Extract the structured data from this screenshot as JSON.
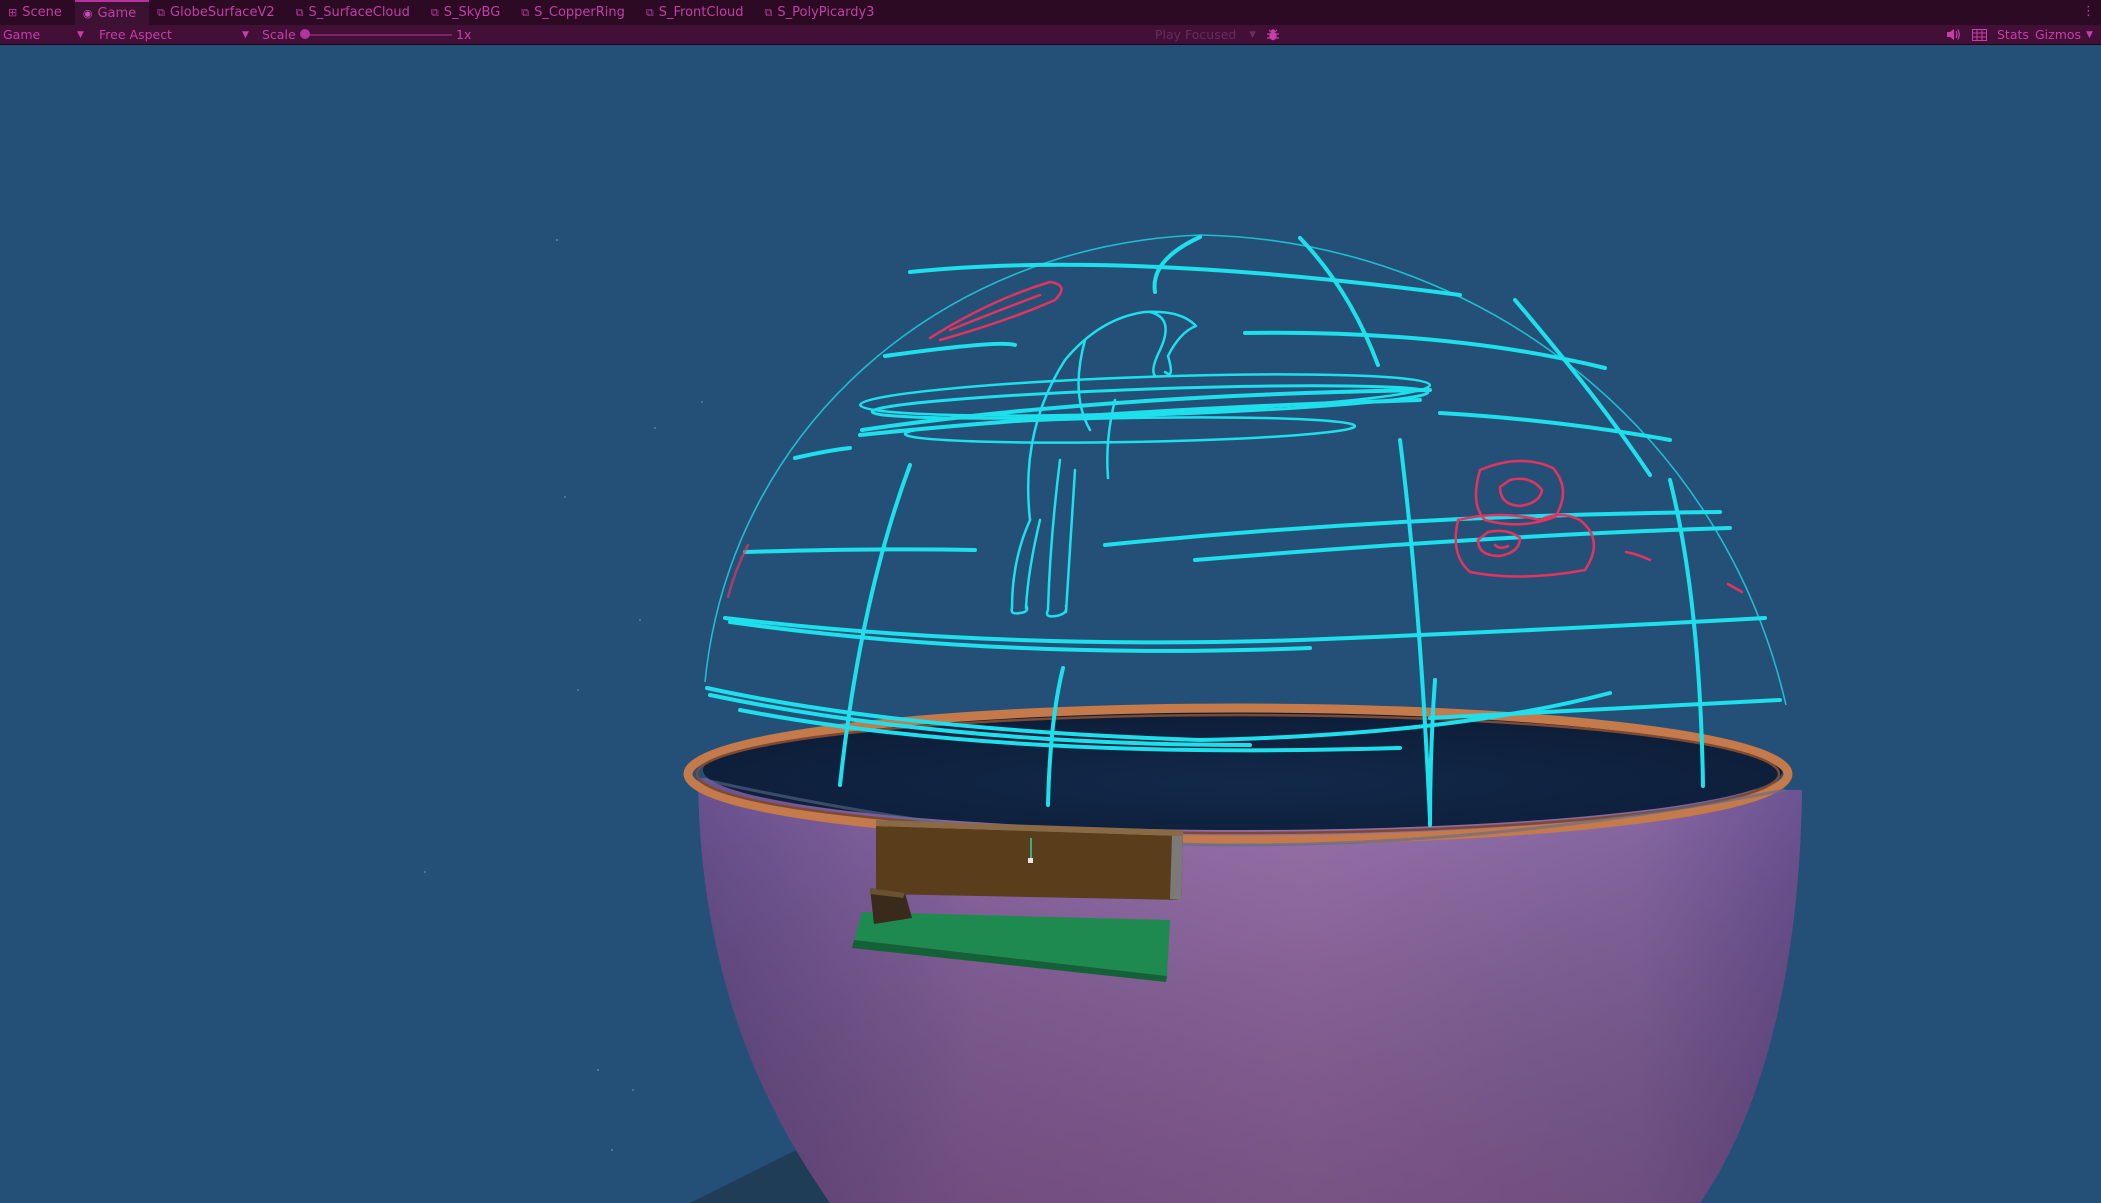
{
  "tabs": [
    {
      "label": "Scene",
      "icon": "grid-icon"
    },
    {
      "label": "Game",
      "icon": "gamepad-icon",
      "active": true
    },
    {
      "label": "GlobeSurfaceV2",
      "icon": "shader-icon"
    },
    {
      "label": "S_SurfaceCloud",
      "icon": "shader-icon"
    },
    {
      "label": "S_SkyBG",
      "icon": "shader-icon"
    },
    {
      "label": "S_CopperRing",
      "icon": "shader-icon"
    },
    {
      "label": "S_FrontCloud",
      "icon": "shader-icon"
    },
    {
      "label": "S_PolyPicardy3",
      "icon": "shader-icon"
    }
  ],
  "more_icon": "kebab-menu-icon",
  "toolbar": {
    "display": "Game",
    "aspect": "Free Aspect",
    "scale_label": "Scale",
    "scale_value": "1x",
    "play_mode": "Play Focused",
    "bug_icon": "bug-icon",
    "mute_icon": "speaker-icon",
    "grid_icon": "grid-table-icon",
    "stats": "Stats",
    "gizmos": "Gizmos"
  },
  "colors": {
    "sky": "#245078",
    "tabbar": "#2c0a23",
    "toolbar": "#420f37",
    "accent_text": "#c23fa8",
    "sketch_cyan": "#1ee0ec",
    "sketch_red": "#e2345f",
    "bowl": "#8a6aa6",
    "copper_ring": "#c47a4a",
    "brown_box": "#5a3e1c",
    "green_board": "#1f8a50"
  }
}
